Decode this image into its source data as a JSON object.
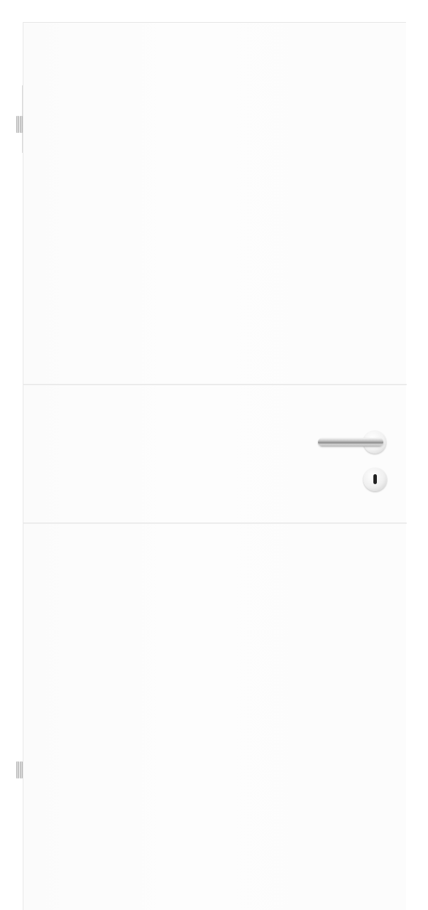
{
  "scene": {
    "subject": "door-icon",
    "colors": {
      "door": "#fcfcfc",
      "groove": "#e6e6e6",
      "metal": "#b0b0b0",
      "keyhole": "#222222"
    }
  }
}
